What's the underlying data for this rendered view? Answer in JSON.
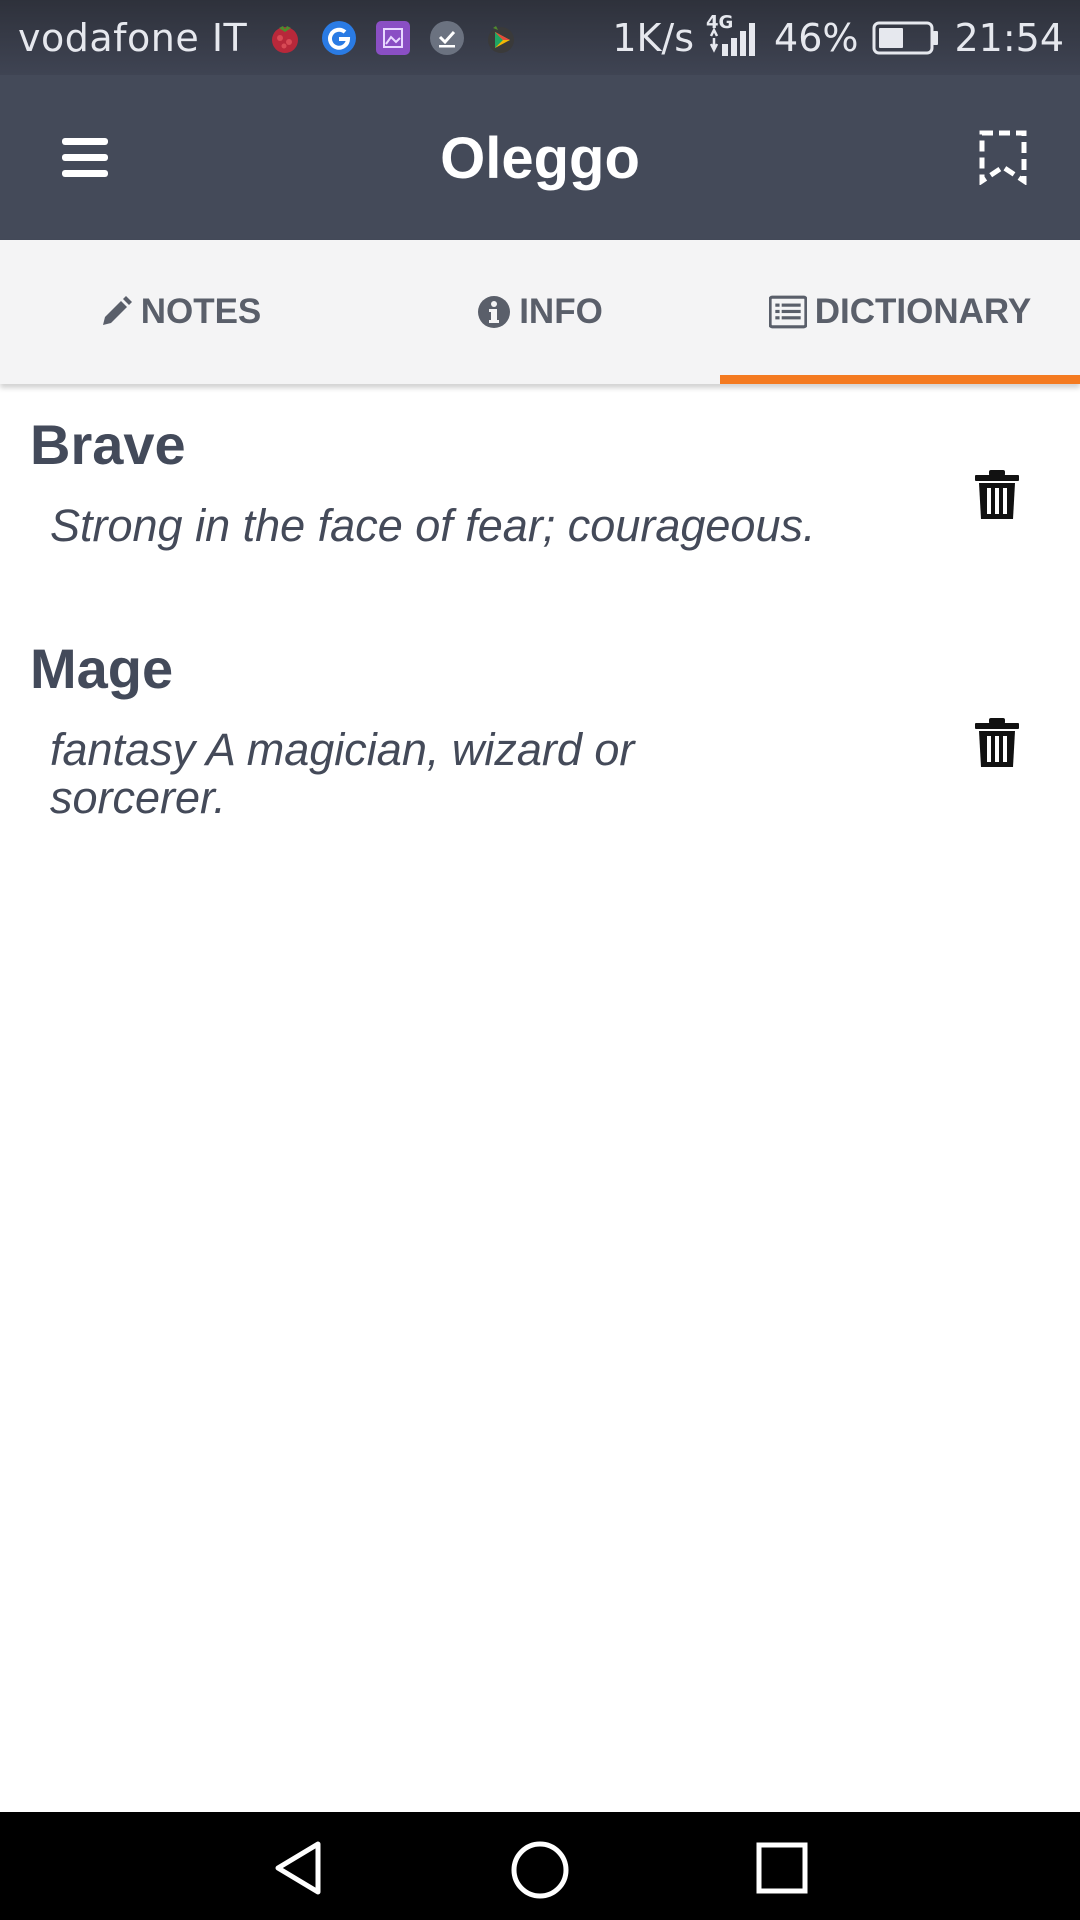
{
  "status_bar": {
    "carrier": "vodafone IT",
    "net_speed": "1K/s",
    "network_type": "4G",
    "battery": "46%",
    "time": "21:54",
    "notification_icons": [
      "raspberry-app-icon",
      "google-icon",
      "gallery-app-icon",
      "tasks-app-icon",
      "play-games-icon"
    ]
  },
  "app_bar": {
    "title": "Oleggo",
    "menu_icon": "hamburger-menu-icon",
    "action_icon": "bookmark-icon"
  },
  "tabs": [
    {
      "label": "NOTES",
      "icon": "pencil-icon",
      "active": false
    },
    {
      "label": "INFO",
      "icon": "info-circle-icon",
      "active": false
    },
    {
      "label": "DICTIONARY",
      "icon": "list-alt-icon",
      "active": true
    }
  ],
  "entries": [
    {
      "word": "Brave",
      "definition": "Strong in the face of fear; courageous.",
      "delete_icon": "trash-icon"
    },
    {
      "word": "Mage",
      "definition": "fantasy A magician, wizard or sorcerer.",
      "delete_icon": "trash-icon"
    }
  ],
  "nav_bar": {
    "back_icon": "back-triangle-icon",
    "home_icon": "home-circle-icon",
    "recents_icon": "recents-square-icon"
  },
  "colors": {
    "app_bar": "#444a59",
    "accent": "#f47a20",
    "tab_background": "#f4f4f5",
    "text_primary": "#434a5a"
  }
}
